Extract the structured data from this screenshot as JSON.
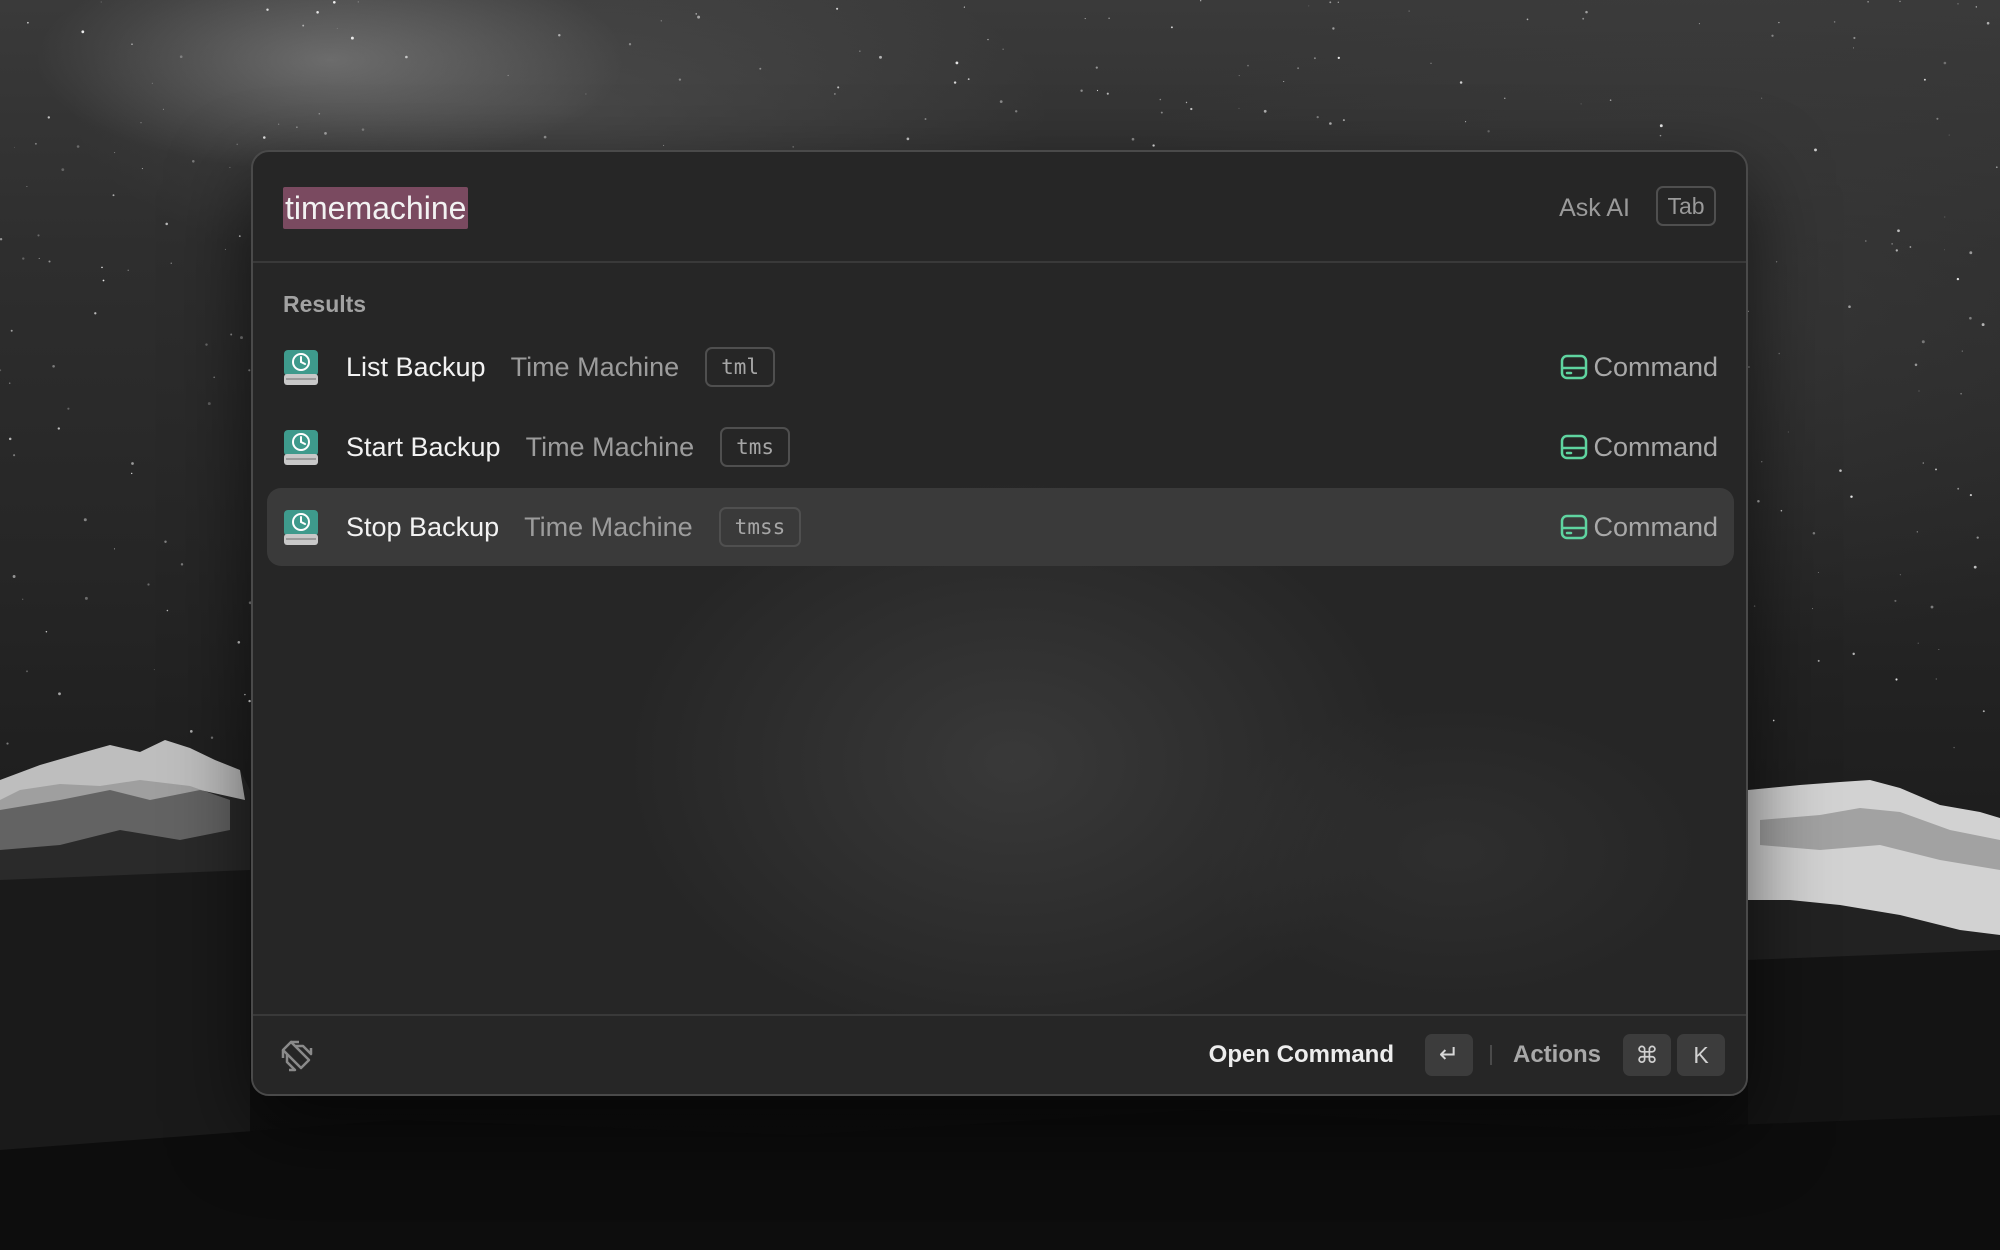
{
  "search": {
    "query": "timemachine",
    "ask_ai_label": "Ask AI",
    "ask_ai_key": "Tab"
  },
  "results": {
    "section_title": "Results",
    "items": [
      {
        "title": "List Backup",
        "subtitle": "Time Machine",
        "alias": "tml",
        "type": "Command",
        "icon": "time-machine-icon",
        "selected": false
      },
      {
        "title": "Start Backup",
        "subtitle": "Time Machine",
        "alias": "tms",
        "type": "Command",
        "icon": "time-machine-icon",
        "selected": false
      },
      {
        "title": "Stop Backup",
        "subtitle": "Time Machine",
        "alias": "tmss",
        "type": "Command",
        "icon": "time-machine-icon",
        "selected": true
      }
    ]
  },
  "footer": {
    "primary_action": "Open Command",
    "primary_key": "↵",
    "actions_label": "Actions",
    "actions_keys": [
      "⌘",
      "K"
    ]
  },
  "colors": {
    "selection_highlight": "#7a4a60",
    "command_icon": "#5fd4a0",
    "selected_row": "#3a3a3a"
  }
}
